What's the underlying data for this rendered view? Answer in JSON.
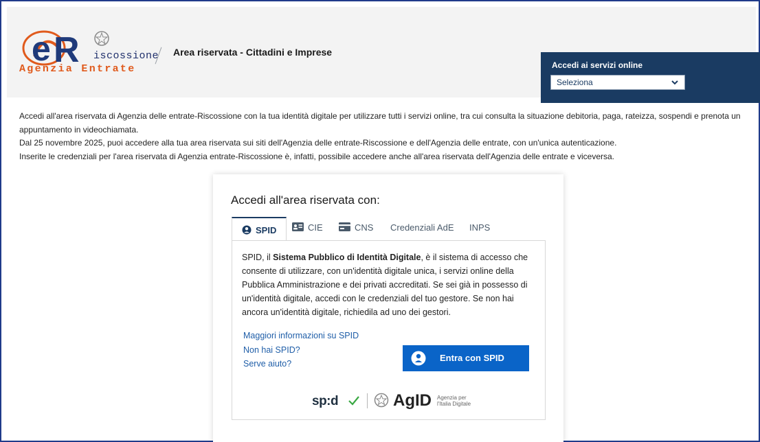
{
  "header": {
    "logo": {
      "brand_sub": "iscossione",
      "brand_name": "Agenzia Entrate"
    },
    "breadcrumb_title": "Area riservata - Cittadini e Imprese",
    "online_services": {
      "label": "Accedi ai servizi online",
      "select_value": "Seleziona"
    }
  },
  "intro": {
    "lines": [
      "Accedi all'area riservata di Agenzia delle entrate-Riscossione con la tua identità digitale per utilizzare tutti i servizi online, tra cui consulta la situazione debitoria, paga, rateizza, sospendi e prenota un appuntamento in videochiamata.",
      "Dal 25 novembre 2025, puoi accedere alla tua area riservata sui siti dell'Agenzia delle entrate-Riscossione e dell'Agenzia delle entrate, con un'unica autenticazione.",
      "Inserite le credenziali per l'area riservata di Agenzia entrate-Riscossione è, infatti, possibile accedere anche all'area riservata dell'Agenzia delle entrate e viceversa."
    ]
  },
  "login": {
    "title": "Accedi all'area riservata con:",
    "tabs": [
      {
        "label": "SPID",
        "icon": "user-circle-icon",
        "active": true
      },
      {
        "label": "CIE",
        "icon": "id-card-icon",
        "active": false
      },
      {
        "label": "CNS",
        "icon": "smart-card-icon",
        "active": false
      },
      {
        "label": "Credenziali AdE",
        "icon": "",
        "active": false
      },
      {
        "label": "INPS",
        "icon": "",
        "active": false
      }
    ],
    "spid_text": {
      "before": "SPID, il ",
      "bold": "Sistema Pubblico di Identità Digitale",
      "after": ", è il sistema di accesso che consente di utilizzare, con un'identità digitale unica, i servizi online della Pubblica Amministrazione e dei privati accreditati. Se sei già in possesso di un'identità digitale, accedi con le credenziali del tuo gestore. Se non hai ancora un'identità digitale, richiedila ad uno dei gestori."
    },
    "links": [
      "Maggiori informazioni su SPID",
      "Non hai SPID?",
      "Serve aiuto?"
    ],
    "spid_button": "Entra con SPID",
    "footer_logos": {
      "spid": "sp:d",
      "agid": "AgID",
      "agid_sub": "Agenzia per l'Italia Digitale"
    }
  },
  "colors": {
    "navy": "#1a3b62",
    "spid_blue": "#0a64c8",
    "link_blue": "#1f5ea8",
    "brand_orange": "#e05a1c"
  }
}
